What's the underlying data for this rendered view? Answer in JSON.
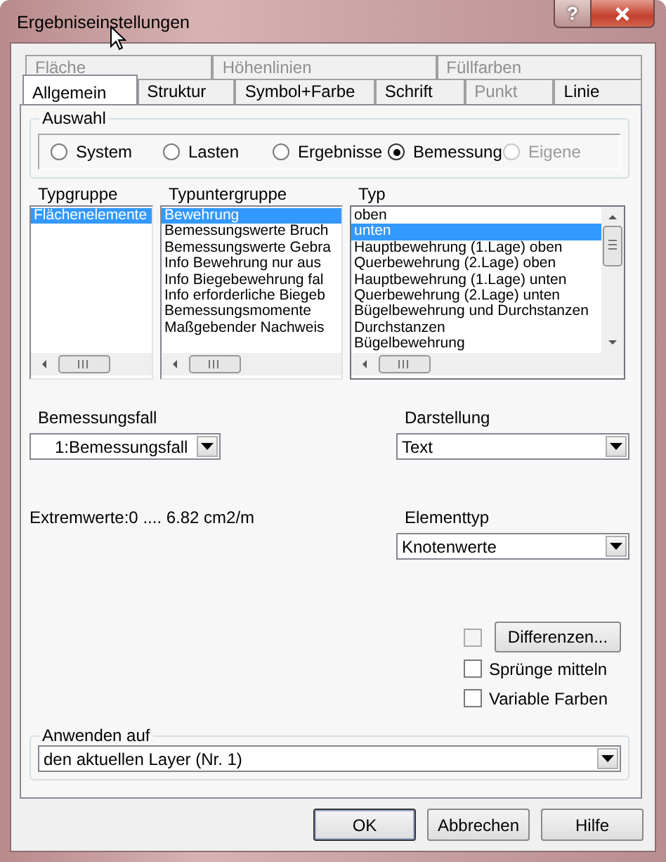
{
  "window": {
    "title": "Ergebniseinstellungen",
    "help_button": "?"
  },
  "tab_rows": [
    [
      {
        "label": "Fläche",
        "selected": false,
        "disabled": true
      },
      {
        "label": "Höhenlinien",
        "selected": false,
        "disabled": true
      },
      {
        "label": "Füllfarben",
        "selected": false,
        "disabled": true
      }
    ],
    [
      {
        "label": "Allgemein",
        "selected": true,
        "disabled": false
      },
      {
        "label": "Struktur",
        "selected": false,
        "disabled": false
      },
      {
        "label": "Symbol+Farbe",
        "selected": false,
        "disabled": false
      },
      {
        "label": "Schrift",
        "selected": false,
        "disabled": false
      },
      {
        "label": "Punkt",
        "selected": false,
        "disabled": true
      },
      {
        "label": "Linie",
        "selected": false,
        "disabled": false
      }
    ]
  ],
  "auswahl": {
    "label": "Auswahl",
    "options": [
      {
        "label": "System",
        "selected": false,
        "disabled": false
      },
      {
        "label": "Lasten",
        "selected": false,
        "disabled": false
      },
      {
        "label": "Ergebnisse",
        "selected": false,
        "disabled": false
      },
      {
        "label": "Bemessung",
        "selected": true,
        "disabled": false
      },
      {
        "label": "Eigene",
        "selected": false,
        "disabled": true
      }
    ]
  },
  "lists": [
    {
      "header": "Typgruppe",
      "vscroll": false,
      "items": [
        {
          "text": "Flächenelemente",
          "selected": true
        }
      ]
    },
    {
      "header": "Typuntergruppe",
      "vscroll": false,
      "items": [
        {
          "text": "Bewehrung",
          "selected": true
        },
        {
          "text": "Bemessungswerte Bruch",
          "selected": false
        },
        {
          "text": "Bemessungswerte Gebra",
          "selected": false
        },
        {
          "text": "Info Bewehrung nur aus",
          "selected": false
        },
        {
          "text": "Info Biegebewehrung fal",
          "selected": false
        },
        {
          "text": "Info erforderliche Biegeb",
          "selected": false
        },
        {
          "text": "Bemessungsmomente",
          "selected": false
        },
        {
          "text": "Maßgebender Nachweis",
          "selected": false
        }
      ]
    },
    {
      "header": "Typ",
      "vscroll": true,
      "items": [
        {
          "text": "oben",
          "selected": false
        },
        {
          "text": "unten",
          "selected": true
        },
        {
          "text": "Hauptbewehrung (1.Lage) oben",
          "selected": false
        },
        {
          "text": "Querbewehrung (2.Lage) oben",
          "selected": false
        },
        {
          "text": "Hauptbewehrung (1.Lage) unten",
          "selected": false
        },
        {
          "text": "Querbewehrung (2.Lage) unten",
          "selected": false
        },
        {
          "text": "Bügelbewehrung und Durchstanzen",
          "selected": false
        },
        {
          "text": "Durchstanzen",
          "selected": false
        },
        {
          "text": "Bügelbewehrung",
          "selected": false
        }
      ]
    }
  ],
  "bemessungsfall": {
    "label": "Bemessungsfall",
    "value": "1:Bemessungsfall"
  },
  "darstellung": {
    "label": "Darstellung",
    "value": "Text"
  },
  "extremwerte": "Extremwerte:0 .... 6.82  cm2/m",
  "elementtyp": {
    "label": "Elementtyp",
    "value": "Knotenwerte"
  },
  "options": [
    {
      "kind": "button-check",
      "label": "Differenzen...",
      "checked": false,
      "disabled": true
    },
    {
      "kind": "check",
      "label": "Sprünge mitteln",
      "checked": false
    },
    {
      "kind": "check",
      "label": "Variable Farben",
      "checked": false
    }
  ],
  "anwenden": {
    "label": "Anwenden auf",
    "value": "den aktuellen Layer (Nr.  1)"
  },
  "buttons": [
    "OK",
    "Abbrechen",
    "Hilfe"
  ]
}
